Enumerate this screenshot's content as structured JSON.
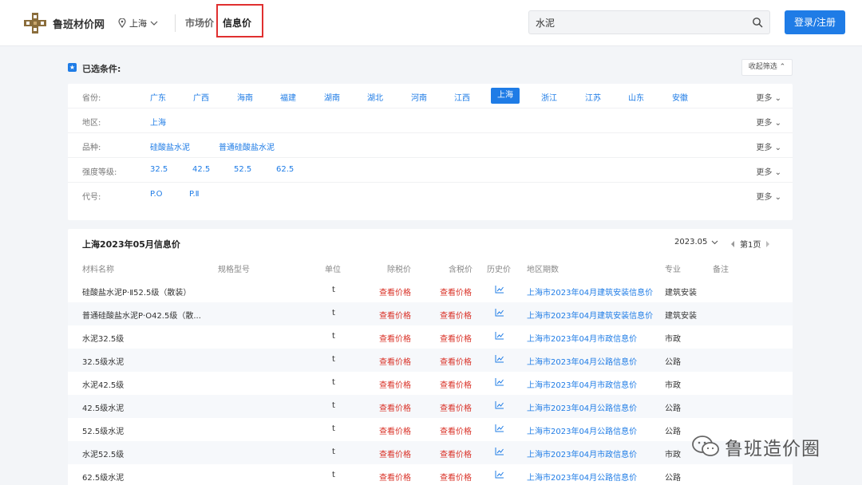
{
  "header": {
    "brand": "鲁班材价网",
    "city": "上海",
    "nav_market": "市场价",
    "nav_info": "信息价",
    "search_value": "水泥",
    "login": "登录/注册"
  },
  "conditions": {
    "title": "已选条件:",
    "collapse": "收起筛选"
  },
  "filters": [
    {
      "label": "省份:",
      "options": [
        "广东",
        "广西",
        "海南",
        "福建",
        "湖南",
        "湖北",
        "河南",
        "江西",
        "上海",
        "浙江",
        "江苏",
        "山东",
        "安徽"
      ],
      "active": "上海",
      "more": "更多"
    },
    {
      "label": "地区:",
      "options": [
        "上海"
      ],
      "more": "更多"
    },
    {
      "label": "品种:",
      "options": [
        "硅酸盐水泥",
        "普通硅酸盐水泥"
      ],
      "more": "更多"
    },
    {
      "label": "强度等级:",
      "options": [
        "32.5",
        "42.5",
        "52.5",
        "62.5"
      ],
      "more": "更多"
    },
    {
      "label": "代号:",
      "options": [
        "P.O",
        "P.Ⅱ"
      ],
      "more": "更多"
    }
  ],
  "table": {
    "title": "上海2023年05月信息价",
    "date": "2023.05",
    "page": "第1页",
    "columns": [
      "材料名称",
      "规格型号",
      "单位",
      "除税价",
      "含税价",
      "历史价",
      "地区期数",
      "专业",
      "备注"
    ],
    "rows": [
      {
        "name": "硅酸盐水泥P·Ⅱ52.5级（散装）",
        "unit": "t",
        "price_ex": "查看价格",
        "price_in": "查看价格",
        "period": "上海市2023年04月建筑安装信息价",
        "major": "建筑安装"
      },
      {
        "name": "普通硅酸盐水泥P·O42.5级（散...",
        "unit": "t",
        "price_ex": "查看价格",
        "price_in": "查看价格",
        "period": "上海市2023年04月建筑安装信息价",
        "major": "建筑安装"
      },
      {
        "name": "水泥32.5级",
        "unit": "t",
        "price_ex": "查看价格",
        "price_in": "查看价格",
        "period": "上海市2023年04月市政信息价",
        "major": "市政"
      },
      {
        "name": "32.5级水泥",
        "unit": "t",
        "price_ex": "查看价格",
        "price_in": "查看价格",
        "period": "上海市2023年04月公路信息价",
        "major": "公路"
      },
      {
        "name": "水泥42.5级",
        "unit": "t",
        "price_ex": "查看价格",
        "price_in": "查看价格",
        "period": "上海市2023年04月市政信息价",
        "major": "市政"
      },
      {
        "name": "42.5级水泥",
        "unit": "t",
        "price_ex": "查看价格",
        "price_in": "查看价格",
        "period": "上海市2023年04月公路信息价",
        "major": "公路"
      },
      {
        "name": "52.5级水泥",
        "unit": "t",
        "price_ex": "查看价格",
        "price_in": "查看价格",
        "period": "上海市2023年04月公路信息价",
        "major": "公路"
      },
      {
        "name": "水泥52.5级",
        "unit": "t",
        "price_ex": "查看价格",
        "price_in": "查看价格",
        "period": "上海市2023年04月市政信息价",
        "major": "市政"
      },
      {
        "name": "62.5级水泥",
        "unit": "t",
        "price_ex": "查看价格",
        "price_in": "查看价格",
        "period": "上海市2023年04月公路信息价",
        "major": "公路"
      }
    ]
  },
  "watermark": "鲁班造价圈",
  "colors": {
    "accent": "#1f7ce6",
    "price_red": "#d93026",
    "highlight_box": "#e03030"
  }
}
